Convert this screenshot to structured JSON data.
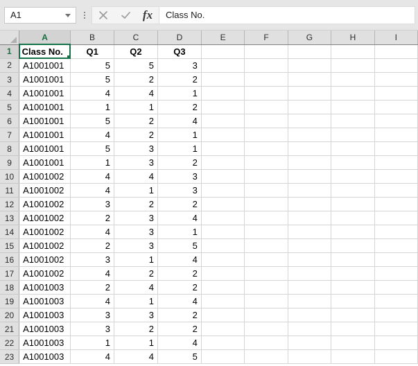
{
  "formula_bar": {
    "name_box_value": "A1",
    "cancel_icon": "close-icon",
    "enter_icon": "checkmark-icon",
    "function_icon": "fx",
    "formula_value": "Class No."
  },
  "sheet": {
    "column_headers": [
      "A",
      "B",
      "C",
      "D",
      "E",
      "F",
      "G",
      "H",
      "I"
    ],
    "active_column": "A",
    "active_row": "1",
    "row_numbers": [
      "1",
      "2",
      "3",
      "4",
      "5",
      "6",
      "7",
      "8",
      "9",
      "10",
      "11",
      "12",
      "13",
      "14",
      "15",
      "16",
      "17",
      "18",
      "19",
      "20",
      "21",
      "22",
      "23"
    ],
    "header_row": [
      "Class No.",
      "Q1",
      "Q2",
      "Q3"
    ],
    "rows": [
      [
        "A1001001",
        "5",
        "5",
        "3"
      ],
      [
        "A1001001",
        "5",
        "2",
        "2"
      ],
      [
        "A1001001",
        "4",
        "4",
        "1"
      ],
      [
        "A1001001",
        "1",
        "1",
        "2"
      ],
      [
        "A1001001",
        "5",
        "2",
        "4"
      ],
      [
        "A1001001",
        "4",
        "2",
        "1"
      ],
      [
        "A1001001",
        "5",
        "3",
        "1"
      ],
      [
        "A1001001",
        "1",
        "3",
        "2"
      ],
      [
        "A1001002",
        "4",
        "4",
        "3"
      ],
      [
        "A1001002",
        "4",
        "1",
        "3"
      ],
      [
        "A1001002",
        "3",
        "2",
        "2"
      ],
      [
        "A1001002",
        "2",
        "3",
        "4"
      ],
      [
        "A1001002",
        "4",
        "3",
        "1"
      ],
      [
        "A1001002",
        "2",
        "3",
        "5"
      ],
      [
        "A1001002",
        "3",
        "1",
        "4"
      ],
      [
        "A1001002",
        "4",
        "2",
        "2"
      ],
      [
        "A1001003",
        "2",
        "4",
        "2"
      ],
      [
        "A1001003",
        "4",
        "1",
        "4"
      ],
      [
        "A1001003",
        "3",
        "3",
        "2"
      ],
      [
        "A1001003",
        "3",
        "2",
        "2"
      ],
      [
        "A1001003",
        "1",
        "1",
        "4"
      ],
      [
        "A1001003",
        "4",
        "4",
        "5"
      ]
    ]
  },
  "colors": {
    "accent_green": "#137547",
    "header_grey": "#e0e0e0",
    "gridline": "#d4d4d4"
  }
}
